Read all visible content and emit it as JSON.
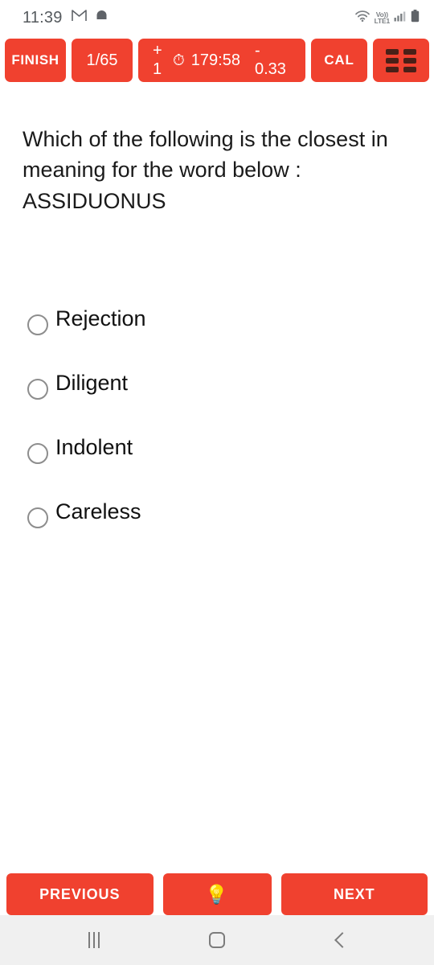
{
  "status_bar": {
    "clock": "11:39",
    "gmail_icon": "gmail-icon",
    "notification_icon": "notification-icon",
    "wifi_icon": "wifi-icon",
    "volte_line1": "Vo))",
    "volte_line2": "LTE1",
    "signal_icon": "signal-bars-icon",
    "battery_icon": "battery-icon"
  },
  "toolbar": {
    "finish_label": "FINISH",
    "question_count": "1/65",
    "plus_mark": "+ 1",
    "watch_icon": "⏱",
    "timer": "179:58",
    "minus_mark": "- 0.33",
    "cal_label": "CAL",
    "grid_icon": "grid-menu-icon",
    "accent_color": "#F0412F"
  },
  "question": {
    "text": "Which of the following is the closest in meaning for the word below : ASSIDUONUS"
  },
  "options": [
    {
      "label": "Rejection",
      "selected": false
    },
    {
      "label": "Diligent",
      "selected": false
    },
    {
      "label": "Indolent",
      "selected": false
    },
    {
      "label": "Careless",
      "selected": false
    }
  ],
  "bottom_bar": {
    "previous_label": "PREVIOUS",
    "hint_icon": "💡",
    "next_label": "NEXT"
  },
  "nav_bar": {
    "recents_icon": "recents-icon",
    "home_icon": "home-icon",
    "back_icon": "back-icon"
  }
}
